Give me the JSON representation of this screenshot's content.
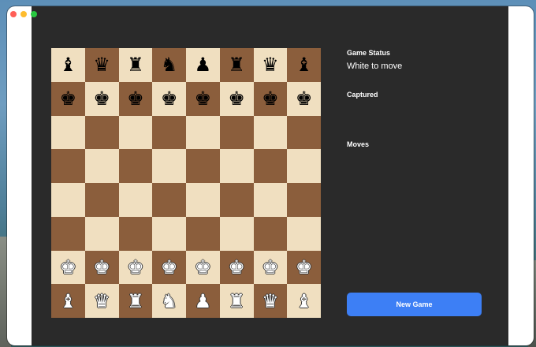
{
  "window": {
    "controls": [
      "close-button",
      "minimize-button",
      "zoom-button"
    ],
    "colors": {
      "close": "#ff5f57",
      "minimize": "#febc2e",
      "zoom": "#28c840",
      "background": "#2a2a2a"
    }
  },
  "board": {
    "colors": {
      "light": "#f0dfc0",
      "dark": "#8b5e3c"
    },
    "ranks": [
      [
        {
          "glyph": "♝",
          "color": "black",
          "name": "black-bishop"
        },
        {
          "glyph": "♛",
          "color": "black",
          "name": "black-queen"
        },
        {
          "glyph": "♜",
          "color": "black",
          "name": "black-rook"
        },
        {
          "glyph": "♞",
          "color": "black",
          "name": "black-knight"
        },
        {
          "glyph": "♟",
          "color": "black",
          "name": "black-pawn"
        },
        {
          "glyph": "♜",
          "color": "black",
          "name": "black-rook"
        },
        {
          "glyph": "♛",
          "color": "black",
          "name": "black-queen"
        },
        {
          "glyph": "♝",
          "color": "black",
          "name": "black-bishop"
        }
      ],
      [
        {
          "glyph": "♚",
          "color": "black",
          "name": "black-king"
        },
        {
          "glyph": "♚",
          "color": "black",
          "name": "black-king"
        },
        {
          "glyph": "♚",
          "color": "black",
          "name": "black-king"
        },
        {
          "glyph": "♚",
          "color": "black",
          "name": "black-king"
        },
        {
          "glyph": "♚",
          "color": "black",
          "name": "black-king"
        },
        {
          "glyph": "♚",
          "color": "black",
          "name": "black-king"
        },
        {
          "glyph": "♚",
          "color": "black",
          "name": "black-king"
        },
        {
          "glyph": "♚",
          "color": "black",
          "name": "black-king"
        }
      ],
      [
        null,
        null,
        null,
        null,
        null,
        null,
        null,
        null
      ],
      [
        null,
        null,
        null,
        null,
        null,
        null,
        null,
        null
      ],
      [
        null,
        null,
        null,
        null,
        null,
        null,
        null,
        null
      ],
      [
        null,
        null,
        null,
        null,
        null,
        null,
        null,
        null
      ],
      [
        {
          "glyph": "♚",
          "color": "white",
          "name": "white-king"
        },
        {
          "glyph": "♚",
          "color": "white",
          "name": "white-king"
        },
        {
          "glyph": "♚",
          "color": "white",
          "name": "white-king"
        },
        {
          "glyph": "♚",
          "color": "white",
          "name": "white-king"
        },
        {
          "glyph": "♚",
          "color": "white",
          "name": "white-king"
        },
        {
          "glyph": "♚",
          "color": "white",
          "name": "white-king"
        },
        {
          "glyph": "♚",
          "color": "white",
          "name": "white-king"
        },
        {
          "glyph": "♚",
          "color": "white",
          "name": "white-king"
        }
      ],
      [
        {
          "glyph": "♝",
          "color": "white",
          "name": "white-bishop"
        },
        {
          "glyph": "♛",
          "color": "white",
          "name": "white-queen"
        },
        {
          "glyph": "♜",
          "color": "white",
          "name": "white-rook"
        },
        {
          "glyph": "♞",
          "color": "white",
          "name": "white-knight"
        },
        {
          "glyph": "♟",
          "color": "white",
          "name": "white-pawn"
        },
        {
          "glyph": "♜",
          "color": "white",
          "name": "white-rook"
        },
        {
          "glyph": "♛",
          "color": "white",
          "name": "white-queen"
        },
        {
          "glyph": "♝",
          "color": "white",
          "name": "white-bishop"
        }
      ]
    ]
  },
  "panel": {
    "status_heading": "Game Status",
    "status_text": "White to move",
    "captured_heading": "Captured",
    "moves_heading": "Moves"
  },
  "actions": {
    "new_game_label": "New Game",
    "accent_color": "#3d7ff5"
  }
}
